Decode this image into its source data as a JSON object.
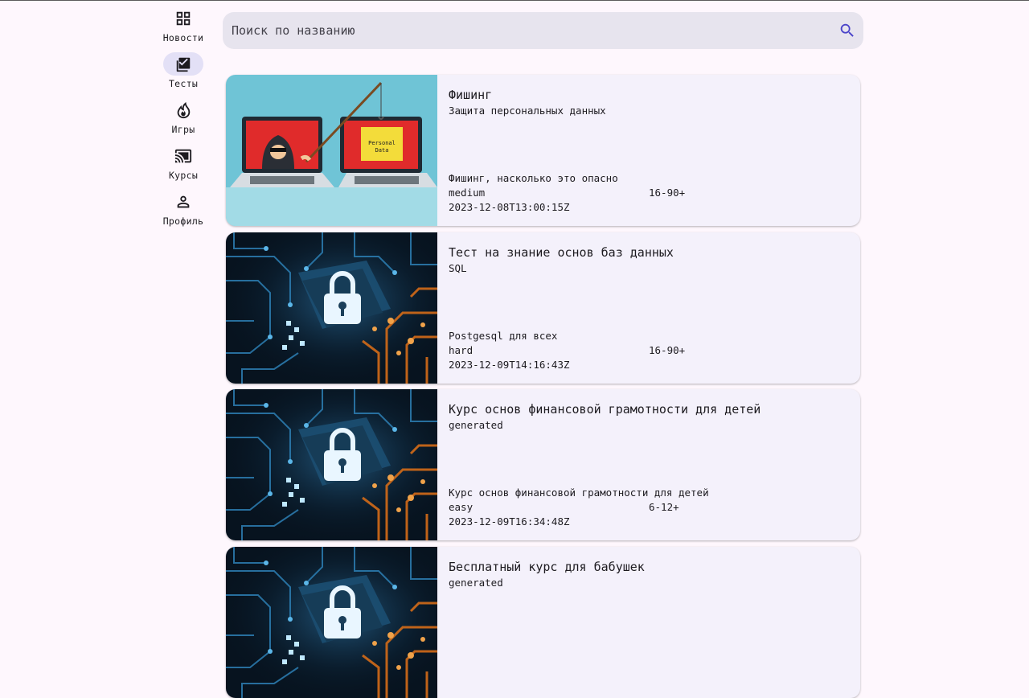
{
  "colors": {
    "background": "#fef7fd",
    "card": "#f4f1fb",
    "search_bg": "#e7e4ee",
    "active_indicator": "#e3e0f6",
    "accent": "#4a43c9"
  },
  "nav": {
    "items": [
      {
        "label": "Новости",
        "icon": "grid-icon",
        "active": false
      },
      {
        "label": "Тесты",
        "icon": "checklist-icon",
        "active": true
      },
      {
        "label": "Игры",
        "icon": "flame-icon",
        "active": false
      },
      {
        "label": "Курсы",
        "icon": "cast-icon",
        "active": false
      },
      {
        "label": "Профиль",
        "icon": "person-icon",
        "active": false
      }
    ]
  },
  "search": {
    "placeholder": "Поиск по названию",
    "value": "",
    "icon": "search-icon"
  },
  "cards": [
    {
      "title": "Фишинг",
      "subtitle": "Защита персональных данных",
      "description": "Фишинг, насколько это опасно",
      "level": "medium",
      "age": "16-90+",
      "date": "2023-12-08T13:00:15Z",
      "image": "phishing-illustration",
      "image_text": "Personal Data"
    },
    {
      "title": "Тест на знание основ баз данных",
      "subtitle": "SQL",
      "description": "Postgesql для всех",
      "level": "hard",
      "age": "16-90+",
      "date": "2023-12-09T14:16:43Z",
      "image": "circuit-lock-image"
    },
    {
      "title": "Курс основ финансовой грамотности для детей",
      "subtitle": "generated",
      "description": "Курс основ финансовой грамотности для детей",
      "level": "easy",
      "age": "6-12+",
      "date": "2023-12-09T16:34:48Z",
      "image": "circuit-lock-image"
    },
    {
      "title": "Бесплатный курс для бабушек",
      "subtitle": "generated",
      "description": "",
      "level": "",
      "age": "",
      "date": "",
      "image": "circuit-lock-image"
    }
  ]
}
